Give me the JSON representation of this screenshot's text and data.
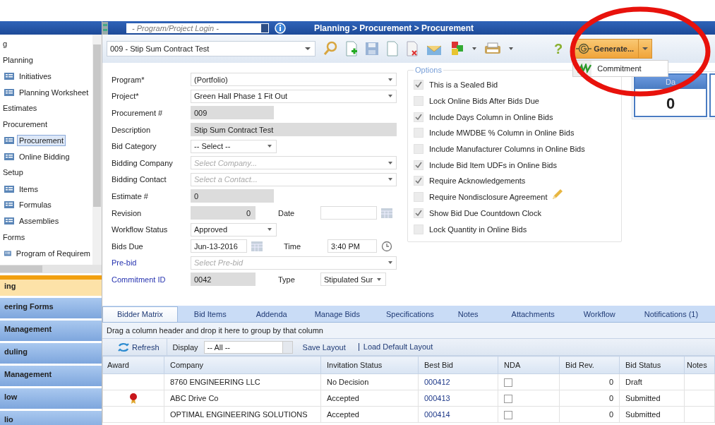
{
  "sidebar": {
    "tree": [
      {
        "label": "g"
      },
      {
        "label": "Planning",
        "children": [
          {
            "label": "Initiatives",
            "selected": false
          },
          {
            "label": "Planning Worksheet",
            "selected": false
          }
        ]
      },
      {
        "label": "Estimates"
      },
      {
        "label": "Procurement",
        "children": [
          {
            "label": "Procurement",
            "selected": true
          },
          {
            "label": "Online Bidding",
            "selected": false
          }
        ]
      },
      {
        "label": "Setup",
        "children": [
          {
            "label": "Items",
            "selected": false
          },
          {
            "label": "Formulas",
            "selected": false
          },
          {
            "label": "Assemblies",
            "selected": false
          }
        ]
      },
      {
        "label": "Forms",
        "children": [
          {
            "label": "Program of Requirem",
            "selected": false
          }
        ]
      }
    ],
    "modules": [
      {
        "label": "ing",
        "selected": true
      },
      {
        "label": "eering Forms",
        "selected": false
      },
      {
        "label": "Management",
        "selected": false
      },
      {
        "label": "duling",
        "selected": false
      },
      {
        "label": "Management",
        "selected": false
      },
      {
        "label": "low",
        "selected": false
      },
      {
        "label": "lio",
        "selected": false
      }
    ]
  },
  "topbar": {
    "login_placeholder": "- Program/Project Login -",
    "breadcrumb": "Planning > Procurement > Procurement"
  },
  "toolbar": {
    "record": "009 -  Stip Sum Contract Test",
    "help": "?",
    "generate": "Generate...",
    "menu": [
      {
        "label": "Commitment"
      }
    ]
  },
  "form": [
    {
      "label": "Program*",
      "link": false,
      "field": {
        "kind": "combo",
        "value": "(Portfolio)"
      }
    },
    {
      "label": "Project*",
      "link": false,
      "field": {
        "kind": "combo",
        "value": "Green Hall Phase 1 Fit Out"
      }
    },
    {
      "label": "Procurement #",
      "link": false,
      "field": {
        "kind": "readonly",
        "value": "009"
      }
    },
    {
      "label": "Description",
      "link": false,
      "field": {
        "kind": "readonly-wide",
        "value": "Stip Sum Contract Test"
      }
    },
    {
      "label": "Bid Category",
      "link": false,
      "field": {
        "kind": "select",
        "value": "-- Select --"
      }
    },
    {
      "label": "Bidding Company",
      "link": false,
      "field": {
        "kind": "combo",
        "placeholder": "Select Company..."
      }
    },
    {
      "label": "Bidding Contact",
      "link": false,
      "field": {
        "kind": "combo",
        "placeholder": "Select a Contact..."
      }
    },
    {
      "label": "Estimate #",
      "link": false,
      "field": {
        "kind": "readonly",
        "value": "0"
      }
    },
    {
      "label": "Revision",
      "link": false,
      "field": {
        "kind": "number",
        "value": "0"
      },
      "extra": {
        "label": "Date",
        "field": {
          "kind": "date"
        }
      }
    },
    {
      "label": "Workflow Status",
      "link": false,
      "field": {
        "kind": "select",
        "value": "Approved"
      }
    },
    {
      "label": "Bids Due",
      "link": false,
      "field": {
        "kind": "date",
        "value": "Jun-13-2016"
      },
      "extra": {
        "label": "Time",
        "field": {
          "kind": "time",
          "value": "3:40 PM"
        }
      }
    },
    {
      "label": "Pre-bid",
      "link": true,
      "field": {
        "kind": "combo",
        "placeholder": "Select Pre-bid"
      }
    },
    {
      "label": "Commitment ID",
      "link": true,
      "field": {
        "kind": "number-left",
        "value": "0042"
      },
      "extra": {
        "label": "Type",
        "field": {
          "kind": "select-small",
          "value": "Stipulated Sur"
        }
      }
    }
  ],
  "options": {
    "title": "Options",
    "items": [
      {
        "label": "This is a Sealed Bid",
        "checked": true,
        "editable": false
      },
      {
        "label": "Lock Online Bids After Bids Due",
        "checked": false,
        "editable": false
      },
      {
        "label": "Include Days Column in Online Bids",
        "checked": true,
        "editable": false
      },
      {
        "label": "Include MWDBE % Column in Online Bids",
        "checked": false,
        "editable": false
      },
      {
        "label": "Include Manufacturer Columns in Online Bids",
        "checked": false,
        "editable": false
      },
      {
        "label": "Include Bid Item UDFs in Online Bids",
        "checked": true,
        "editable": false
      },
      {
        "label": "Require Acknowledgements",
        "checked": true,
        "editable": false
      },
      {
        "label": "Require Nondisclosure Agreement",
        "checked": false,
        "editable": true
      },
      {
        "label": "Show Bid Due Countdown Clock",
        "checked": true,
        "editable": false
      },
      {
        "label": "Lock Quantity in Online Bids",
        "checked": false,
        "editable": false
      }
    ]
  },
  "countdown": {
    "header": "Da",
    "value": "0"
  },
  "tabs": [
    {
      "label": "Bidder Matrix",
      "selected": true
    },
    {
      "label": "Bid Items",
      "selected": false
    },
    {
      "label": "Addenda",
      "selected": false
    },
    {
      "label": "Manage Bids",
      "selected": false
    },
    {
      "label": "Specifications",
      "selected": false
    },
    {
      "label": "Notes",
      "selected": false
    },
    {
      "label": "Attachments",
      "selected": false
    },
    {
      "label": "Workflow",
      "selected": false
    },
    {
      "label": "Notifications (1)",
      "selected": false
    }
  ],
  "group_hint": "Drag a column header and drop it here to group by that column",
  "grid_toolbar": {
    "refresh": "Refresh",
    "display_label": "Display",
    "display_value": "-- All --",
    "save": "Save Layout",
    "load": "Load Default Layout"
  },
  "table": {
    "columns": [
      "Award",
      "Company",
      "Invitation Status",
      "Best Bid",
      "NDA",
      "Bid Rev.",
      "Bid Status",
      "Notes"
    ],
    "rows": [
      {
        "award": false,
        "company": "8760 ENGINEERING LLC",
        "invitation": "No Decision",
        "best_bid": "000412",
        "nda": false,
        "bid_rev": "0",
        "bid_status": "Draft"
      },
      {
        "award": true,
        "company": "ABC Drive Co",
        "invitation": "Accepted",
        "best_bid": "000413",
        "nda": false,
        "bid_rev": "0",
        "bid_status": "Submitted"
      },
      {
        "award": false,
        "company": "OPTIMAL ENGINEERING SOLUTIONS",
        "invitation": "Accepted",
        "best_bid": "000414",
        "nda": false,
        "bid_rev": "0",
        "bid_status": "Submitted"
      }
    ]
  }
}
